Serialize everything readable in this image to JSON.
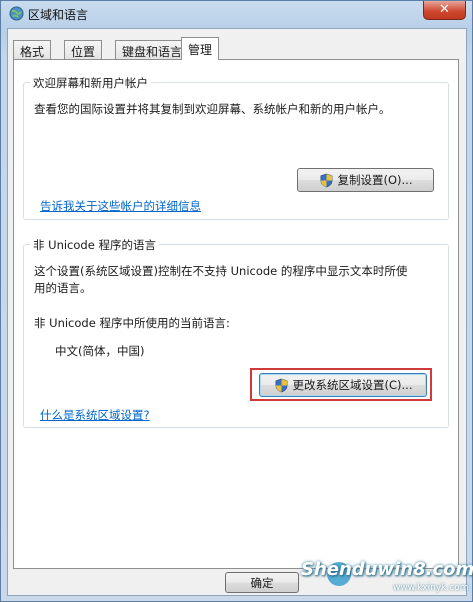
{
  "window": {
    "title": "区域和语言",
    "close_label": "✕"
  },
  "tabs": [
    {
      "label": "格式",
      "active": false
    },
    {
      "label": "位置",
      "active": false
    },
    {
      "label": "键盘和语言",
      "active": false
    },
    {
      "label": "管理",
      "active": true
    }
  ],
  "welcome_group": {
    "title": "欢迎屏幕和新用户帐户",
    "description": "查看您的国际设置并将其复制到欢迎屏幕、系统帐户和新的用户帐户。",
    "copy_button": "复制设置(O)...",
    "link": "告诉我关于这些帐户的详细信息"
  },
  "unicode_group": {
    "title": "非 Unicode 程序的语言",
    "description_line1": "这个设置(系统区域设置)控制在不支持 Unicode 的程序中显示文本时所使",
    "description_line2": "用的语言。",
    "current_label": "非 Unicode 程序中所使用的当前语言:",
    "current_value": "中文(简体，中国)",
    "change_button": "更改系统区域设置(C)...",
    "link": "什么是系统区域设置?"
  },
  "footer": {
    "ok_button": "确定"
  },
  "watermark": {
    "text": "Shenduwin8.com",
    "sub": "www.kxinyk.com"
  },
  "colors": {
    "highlight": "#d03a3a",
    "link": "#0066cc",
    "close": "#c0381f"
  }
}
